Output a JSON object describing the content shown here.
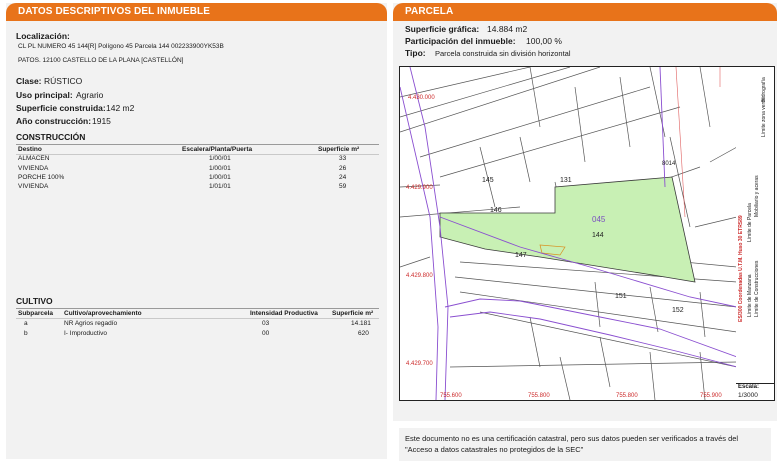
{
  "left_panel": {
    "header": "DATOS DESCRIPTIVOS DEL INMUEBLE",
    "localizacion_label": "Localización:",
    "localizacion_line1": "CL PL NUMERO 45 144[R] Polígono 45 Parcela 144 002233900YK53B",
    "localizacion_line2": "PATOS. 12100 CASTELLO DE LA PLANA [CASTELLÓN]",
    "clase_label": "Clase:",
    "clase_value": "RÚSTICO",
    "uso_label": "Uso principal:",
    "uso_value": "Agrario",
    "sup_label": "Superficie construida:",
    "sup_value": "142 m2",
    "anio_label": "Año construcción:",
    "anio_value": "1915",
    "construccion": {
      "title": "CONSTRUCCIÓN",
      "headers": [
        "Destino",
        "Escalera/Planta/Puerta",
        "Superficie m²"
      ],
      "rows": [
        [
          "ALMACEN",
          "1/00/01",
          "33"
        ],
        [
          "VIVIENDA",
          "1/00/01",
          "26"
        ],
        [
          "PORCHE 100%",
          "1/00/01",
          "24"
        ],
        [
          "VIVIENDA",
          "1/01/01",
          "59"
        ]
      ]
    },
    "cultivo": {
      "title": "CULTIVO",
      "headers": [
        "Subparcela",
        "Cultivo/aprovechamiento",
        "Intensidad Productiva",
        "Superficie m²"
      ],
      "rows": [
        [
          "a",
          "NR Agrios regadío",
          "03",
          "14.181"
        ],
        [
          "b",
          "I- Improductivo",
          "00",
          "620"
        ]
      ]
    }
  },
  "right_panel": {
    "header": "PARCELA",
    "sup_grafica_label": "Superficie gráfica:",
    "sup_grafica_value": "14.884 m2",
    "participacion_label": "Participación del inmueble:",
    "participacion_value": "100,00 %",
    "tipo_label": "Tipo:",
    "tipo_value": "Parcela construida sin división horizontal",
    "map_labels": {
      "parcel_number": "144",
      "parcel_sub": "045",
      "n131": "131",
      "n145": "145",
      "n146": "146",
      "n147": "147",
      "n151": "151",
      "n152": "152",
      "n8014": "8014",
      "coord1": "4.430.000",
      "coord2": "4.429.900",
      "coord3": "4.429.800",
      "coord4": "4.429.700",
      "x1": "755.600",
      "x2": "755.800",
      "x3": "755.800",
      "x4": "755.900"
    },
    "legend": [
      "Límite de Manzana",
      "Límite de Parcela",
      "Límite de Construcciones",
      "Mobiliario y aceras",
      "Límite zona verde",
      "Hidrografía"
    ],
    "legend_coord": "ES/300 Coordenadas U.T.M. Huso 30 ETRS89",
    "escala_label": "Escala:",
    "escala_value": "1/3000",
    "note": "Este documento no es una certificación catastral, pero sus datos pueden ser verificados a través del \"Acceso a datos catastrales no protegidos de la SEC\""
  },
  "colors": {
    "accent": "#e8731a",
    "parcel_fill": "#c8f0b4",
    "path_purple": "#8a4fd0",
    "red_labels": "#cc2a2a"
  }
}
